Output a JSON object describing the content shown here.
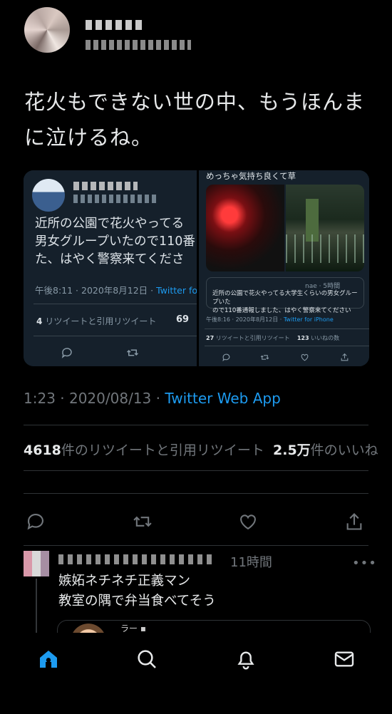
{
  "tweet": {
    "text": "花火もできない世の中、もうほんま\nに泣けるね。",
    "timestamp": "1:23 · 2020/08/13 · ",
    "source": "Twitter Web App",
    "retweet_count": "4618",
    "retweet_label": "件のリツイートと引用リツイート",
    "like_count": "2.5万",
    "like_label": "件のいいね"
  },
  "quote_left": {
    "text": "近所の公園で花火やってる\n男女グループいたので110番\nた、はやく警察来てくださ",
    "date": "午後8:11 · 2020年8月12日 · ",
    "source": "Twitter for",
    "retweets": "4",
    "retweets_label": "リツイートと引用リツイート",
    "likes": "69"
  },
  "quote_right": {
    "top_text": "めっちゃ気持ち良くて草",
    "quoted_handle": "nae · 5時間",
    "quoted_text": "近所の公園で花火やってる大学生くらいの男女グループいた\nので110番通報しました、はやく警察来てください",
    "date": "午後8:16 · 2020年8月12日 · ",
    "source": "Twitter for iPhone",
    "retweets": "27",
    "retweets_label": "リツイートと引用リツイート",
    "likes": "123",
    "likes_label": "いいねの数"
  },
  "reply": {
    "time": "11時間",
    "more": "•••",
    "text": "嫉妬ネチネチ正義マン\n教室の隅で弁当食べてそう",
    "card_name": "ラー ▪"
  },
  "icons": {
    "actions": [
      "reply-icon",
      "retweet-icon",
      "like-icon",
      "share-icon"
    ],
    "tabs": [
      "home-icon",
      "search-icon",
      "notifications-icon",
      "messages-icon"
    ]
  },
  "colors": {
    "accent": "#1d9bf0",
    "muted": "#71767b",
    "background": "#000000",
    "card": "#15202b"
  }
}
